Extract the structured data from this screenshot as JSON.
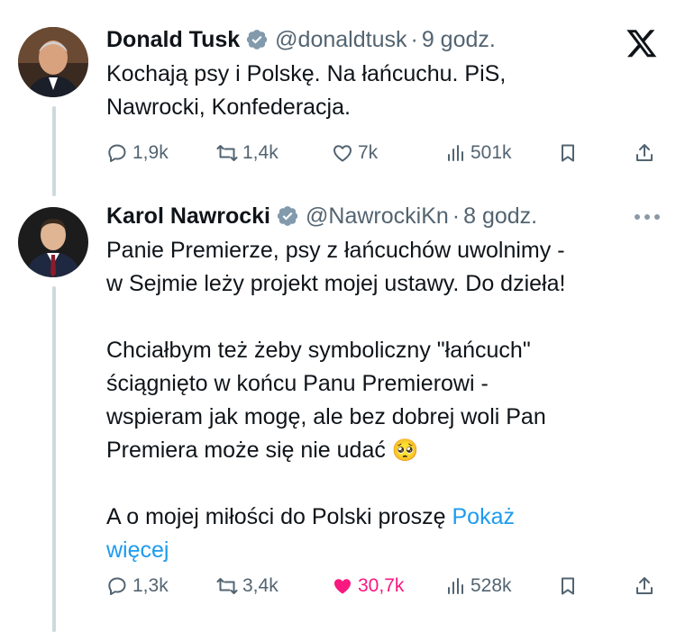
{
  "tweets": [
    {
      "author_name": "Donald Tusk",
      "handle": "@donaldtusk",
      "separator": "·",
      "time": "9 godz.",
      "text": "Kochają psy i Polskę. Na łańcuchu. PiS,\nNawrocki, Konfederacja.",
      "actions": {
        "replies": "1,9k",
        "reposts": "1,4k",
        "likes": "7k",
        "views": "501k",
        "liked": false
      }
    },
    {
      "author_name": "Karol Nawrocki",
      "handle": "@NawrockiKn",
      "separator": "·",
      "time": "8 godz.",
      "text": "Panie Premierze, psy z łańcuchów uwolnimy -\nw Sejmie leży projekt mojej ustawy. Do dzieła!\n\nChciałbym też żeby symboliczny \"łańcuch\"\nściągnięto w końcu Panu Premierowi -\nwspieram jak mogę, ale bez dobrej woli Pan\nPremiera może się nie udać",
      "emoji": "🥺",
      "text_tail": "\n\nA o mojej miłości do Polski proszę ",
      "show_more": "Pokaż\nwięcej",
      "actions": {
        "replies": "1,3k",
        "reposts": "3,4k",
        "likes": "30,7k",
        "views": "528k",
        "liked": true
      }
    }
  ],
  "colors": {
    "accent": "#1d9bf0",
    "like": "#f91880",
    "verified": "#829aab",
    "muted": "#536471"
  },
  "icons": [
    "x-logo-icon",
    "verified-badge-icon",
    "reply-icon",
    "repost-icon",
    "heart-icon",
    "views-icon",
    "bookmark-icon",
    "share-icon",
    "more-icon"
  ]
}
